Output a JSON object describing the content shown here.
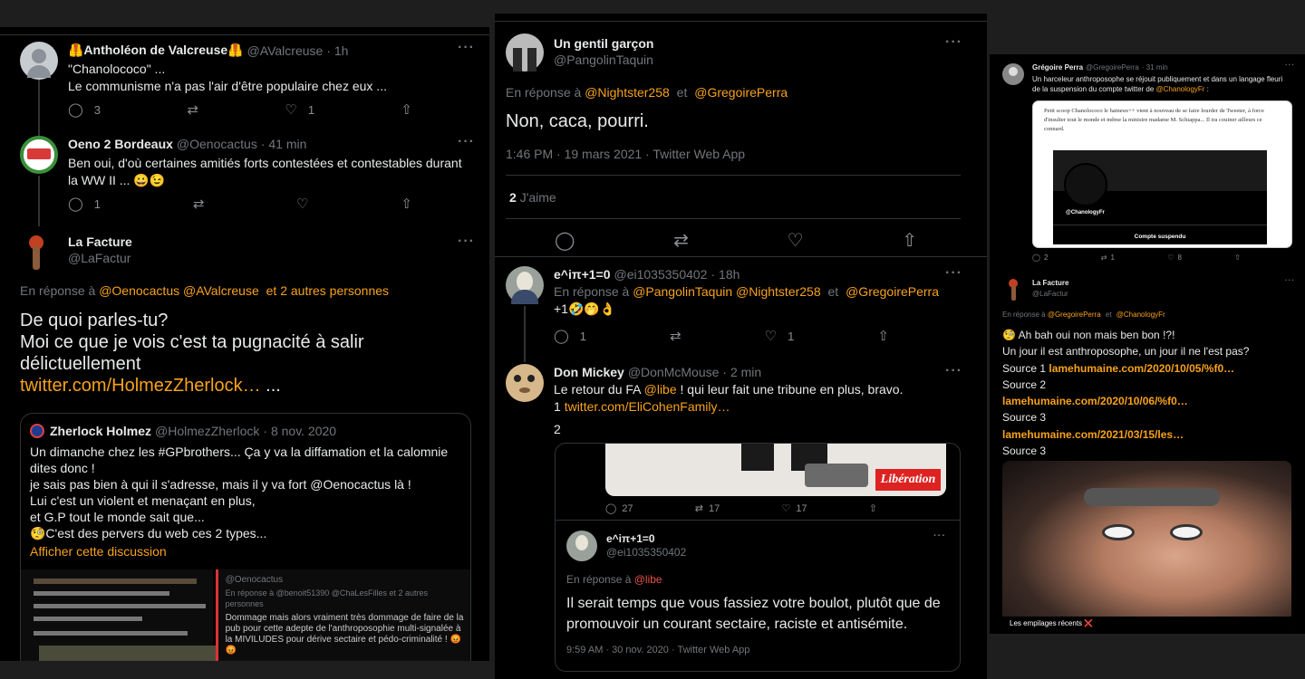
{
  "panel1": {
    "tweet1": {
      "name": "🦺Antholéon de Valcreuse🦺",
      "handle": "@AValcreuse",
      "time": "· 1h",
      "line1": "\"Chanolococo\" ...",
      "line2": "Le communisme n'a pas l'air d'être populaire chez eux ...",
      "replies": "3",
      "likes": "1"
    },
    "tweet2": {
      "name": "Oeno 2 Bordeaux",
      "handle": "@Oenocactus",
      "time": "· 41 min",
      "text": "Ben oui, d'où certaines amitiés forts contestées et contestables durant la WW II ... 😀😉",
      "replies": "1"
    },
    "tweet3": {
      "name": "La Facture",
      "handle": "@LaFactur",
      "reply_prefix": "En réponse à",
      "reply_users": "@Oenocactus @AValcreuse",
      "reply_suffix": "et 2 autres personnes",
      "text_line1": "De quoi parles-tu?",
      "text_line2": "Moi ce que je vois c'est ta pugnacité à salir délictuellement",
      "link": "twitter.com/HolmezZherlock…",
      "link_suffix": " ..."
    },
    "quote": {
      "name": "Zherlock Holmez",
      "handle": "@HolmezZherlock",
      "time": "· 8 nov. 2020",
      "l1": "Un dimanche chez les #GPbrothers... Ça y va la diffamation et la calomnie dites donc !",
      "l2": " je sais pas bien à qui il s'adresse, mais il y va fort @Oenocactus là !",
      "l3": " Lui c'est un violent et menaçant en plus,",
      "l4": " et G.P tout le monde sait que...",
      "l5": "🧐C'est des pervers du web ces 2 types...",
      "show_thread": "Afficher cette discussion",
      "img_right_user": "@Oenocactus",
      "img_right_reply": "En réponse à @benoit51390 @ChaLesFilles et 2 autres personnes",
      "img_right_text": "Dommage mais alors vraiment très dommage de faire de la pub pour cette adepte de l'anthroposophie multi-signalée à la MIVILUDES pour dérive sectaire et pédo-criminalité ! 😡😡"
    }
  },
  "panel2": {
    "main": {
      "name": "Un gentil garçon",
      "handle": "@PangolinTaquin",
      "reply_prefix": "En réponse à",
      "reply_user1": "@Nightster258",
      "reply_and": "et",
      "reply_user2": "@GregoirePerra",
      "text": "Non, caca, pourri.",
      "timestamp": "1:46 PM · 19 mars 2021 · Twitter Web App",
      "likes_count": "2",
      "likes_label": "J'aime"
    },
    "reply1": {
      "name": "e^iπ+1=0",
      "handle": "@ei1035350402",
      "time": "· 18h",
      "reply_prefix": "En réponse à",
      "reply_users": "@PangolinTaquin @Nightster258",
      "reply_and": "et",
      "reply_user3": "@GregoirePerra",
      "text": "+1🤣🤭👌",
      "replies": "1",
      "likes": "1"
    },
    "reply2": {
      "name": "Don Mickey",
      "handle": "@DonMcMouse",
      "time": "· 2 min",
      "text_pre": "Le retour du FA ",
      "mention": "@libe",
      "text_post": " ! qui leur fait une tribune en plus, bravo.",
      "line2_pre": "1 ",
      "link": "twitter.com/EliCohenFamily…",
      "line3": "2"
    },
    "embed": {
      "brand": "Libération",
      "replies": "27",
      "retweets": "17",
      "likes": "17",
      "name": "e^iπ+1=0",
      "handle": "@ei1035350402",
      "reply_prefix": "En réponse à",
      "reply_user": "@libe",
      "text": "Il serait temps que vous fassiez votre boulot, plutôt que de promouvoir un courant sectaire, raciste et antisémite.",
      "timestamp": "9:59 AM · 30 nov. 2020 · Twitter Web App"
    }
  },
  "panel3": {
    "gp": {
      "name": "Grégoire Perra",
      "handle": "@GregoirePerra",
      "time": "· 31 min",
      "text_pre": "Un harceleur anthroposophe se réjouit publiquement et dans un langage fleuri de la suspension du compte twitter de ",
      "mention": "@ChanologyFr",
      "text_post": " :",
      "card_text": "Petit scoop Chanolococo le haineux++ vient à nouveau de se faire lourder de Tweeter, à force d'insulter tout le monde et même la ministre madame M. Schiappa... Il ira couiner ailleurs ce connard.",
      "card_handle": "@ChanologyFr",
      "card_status": "Compte suspendu",
      "replies": "2",
      "retweets": "1",
      "likes": "8"
    },
    "lf": {
      "name": "La Facture",
      "handle": "@LaFactur",
      "reply_prefix": "En réponse à",
      "reply_user1": "@GregoirePerra",
      "reply_and": "et",
      "reply_user2": "@ChanologyFr",
      "l1": "🧐 Ah bah oui non mais ben bon !?!",
      "l2": " Un jour il est anthroposophe, un jour il ne l'est pas?",
      "src1_label": "Source 1 ",
      "src1_link": "lamehumaine.com/2020/10/05/%f0…",
      "src2_label": "Source 2",
      "src2_link": "lamehumaine.com/2020/10/06/%f0…",
      "src3_label": "Source 3",
      "src3_link": " lamehumaine.com/2021/03/15/les…",
      "src4_label": "Source 3",
      "img_caption": "Les empilages récents ❌"
    }
  }
}
